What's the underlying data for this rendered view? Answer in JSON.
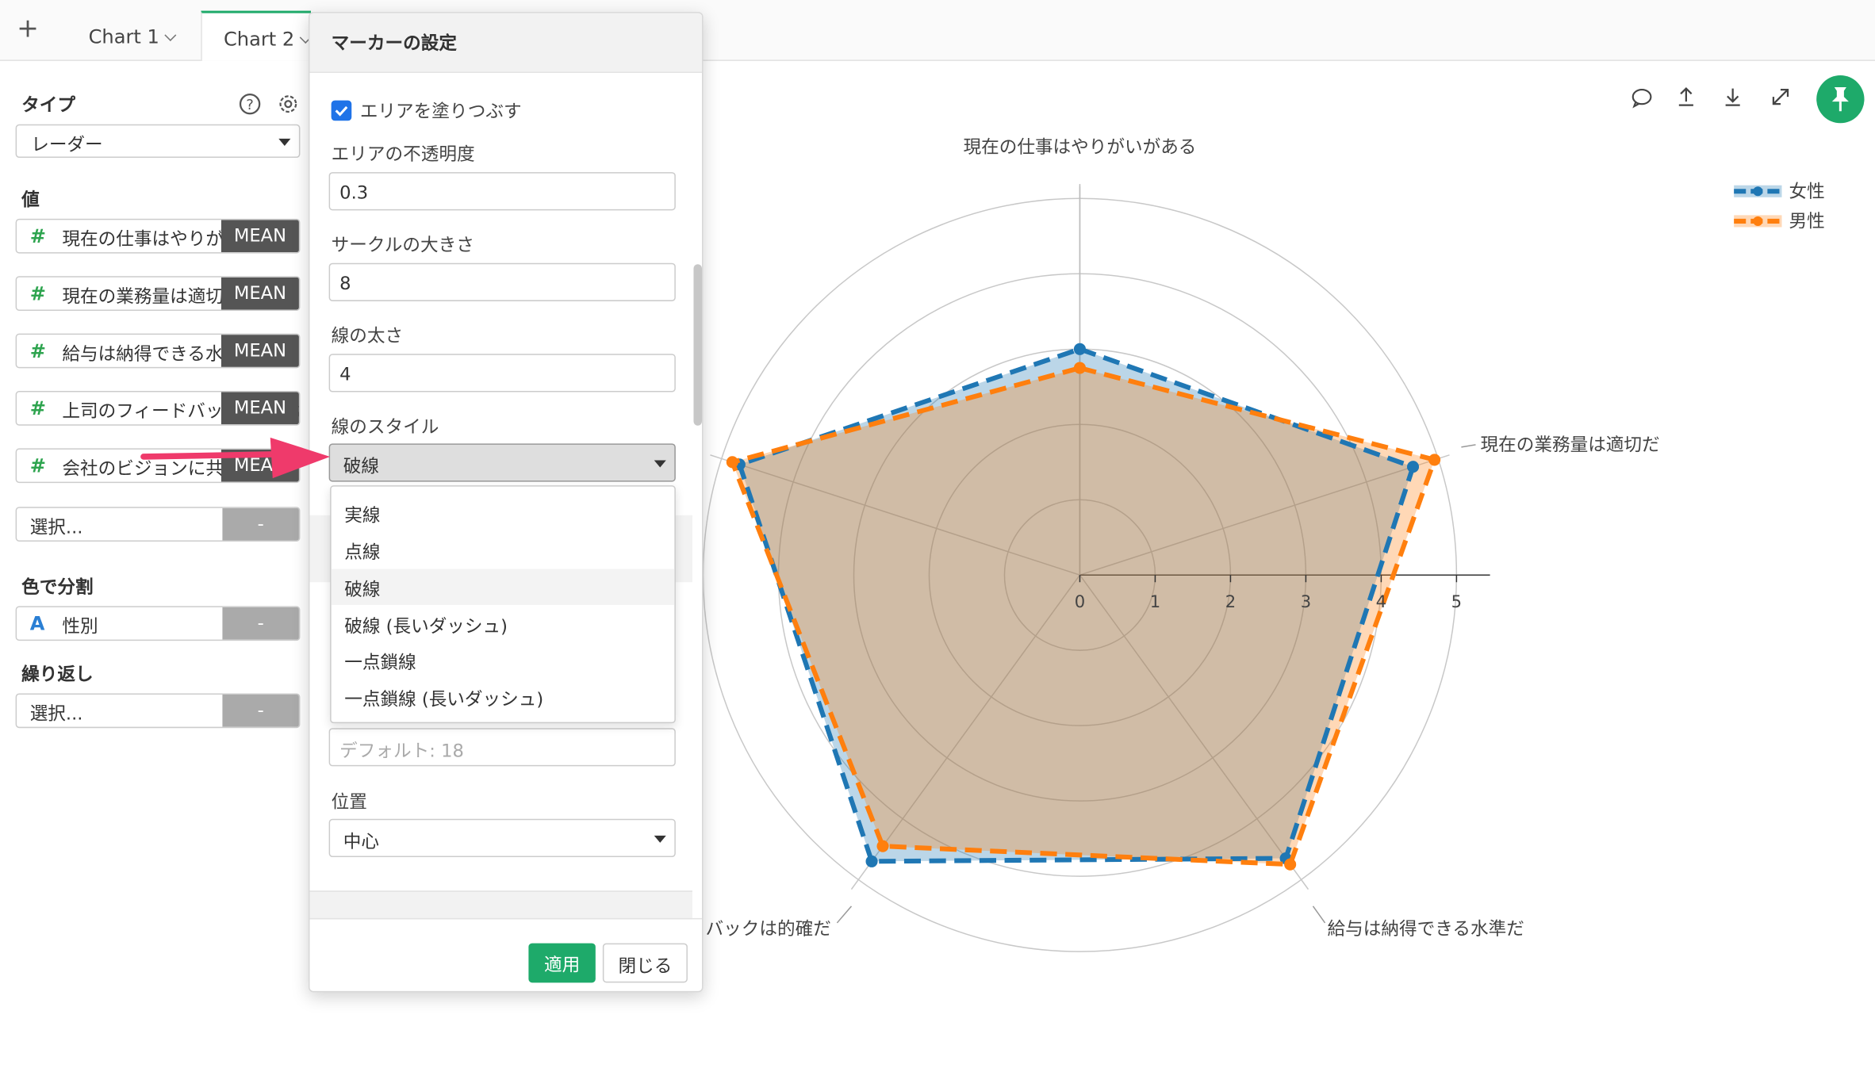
{
  "tabs": {
    "add_label": "+",
    "items": [
      {
        "label": "Chart 1"
      },
      {
        "label": "Chart 2"
      }
    ]
  },
  "left_panel": {
    "type_title": "タイプ",
    "type_value": "レーダー",
    "values_title": "値",
    "value_fields": [
      {
        "icon": "#",
        "label": "現在の仕事はやりがいがある",
        "agg": "MEAN"
      },
      {
        "icon": "#",
        "label": "現在の業務量は適切だ",
        "agg": "MEAN"
      },
      {
        "icon": "#",
        "label": "給与は納得できる水準だ",
        "agg": "MEAN"
      },
      {
        "icon": "#",
        "label": "上司のフィードバックは的確だ",
        "agg": "MEAN"
      },
      {
        "icon": "#",
        "label": "会社のビジョンに共感する",
        "agg": "MEAN"
      }
    ],
    "value_select_placeholder": "選択...",
    "value_select_btn": "-",
    "color_title": "色で分割",
    "color_field": {
      "icon": "A",
      "label": "性別",
      "btn": "-"
    },
    "repeat_title": "繰り返し",
    "repeat_placeholder": "選択...",
    "repeat_btn": "-"
  },
  "toolbar": {
    "icons": [
      "comment-icon",
      "upload-icon",
      "download-icon",
      "expand-icon",
      "pin-icon"
    ]
  },
  "dialog": {
    "title": "マーカーの設定",
    "fill_area_label": "エリアを塗りつぶす",
    "fill_area_checked": true,
    "opacity_label": "エリアの不透明度",
    "opacity_value": "0.3",
    "circle_size_label": "サークルの大きさ",
    "circle_size_value": "8",
    "line_width_label": "線の太さ",
    "line_width_value": "4",
    "line_style_label": "線のスタイル",
    "line_style_value": "破線",
    "line_style_options": [
      "実線",
      "点線",
      "破線",
      "破線 (長いダッシュ)",
      "一点鎖線",
      "一点鎖線 (長いダッシュ)"
    ],
    "font_size_placeholder": "デフォルト: 18",
    "position_label": "位置",
    "position_value": "中心",
    "apply_label": "適用",
    "close_label": "閉じる"
  },
  "colors": {
    "accent": "#1eaa6a",
    "female": "#1f77b4",
    "male": "#ff7f0e"
  },
  "chart_data": {
    "type": "radar",
    "axes": [
      "現在の仕事はやりがいがある",
      "現在の業務量は適切だ",
      "給与は納得できる水準だ",
      "上司のフィードバックは的確だ",
      "会社のビジョンに共感する"
    ],
    "axis_visible_labels": [
      "現在の仕事はやりがいがある",
      "現在の業務量は適切だ",
      "給与は納得できる水準だ",
      "バックは的確だ"
    ],
    "ticks": [
      "0",
      "1",
      "2",
      "3",
      "4",
      "5"
    ],
    "rlim": [
      0,
      5
    ],
    "series": [
      {
        "name": "女性",
        "color": "#1f77b4",
        "values": [
          3.0,
          4.65,
          4.65,
          4.7,
          4.75
        ]
      },
      {
        "name": "男性",
        "color": "#ff7f0e",
        "values": [
          2.75,
          4.95,
          4.75,
          4.45,
          4.85
        ]
      }
    ],
    "legend_position": "top-right",
    "line_style": "dashed"
  }
}
